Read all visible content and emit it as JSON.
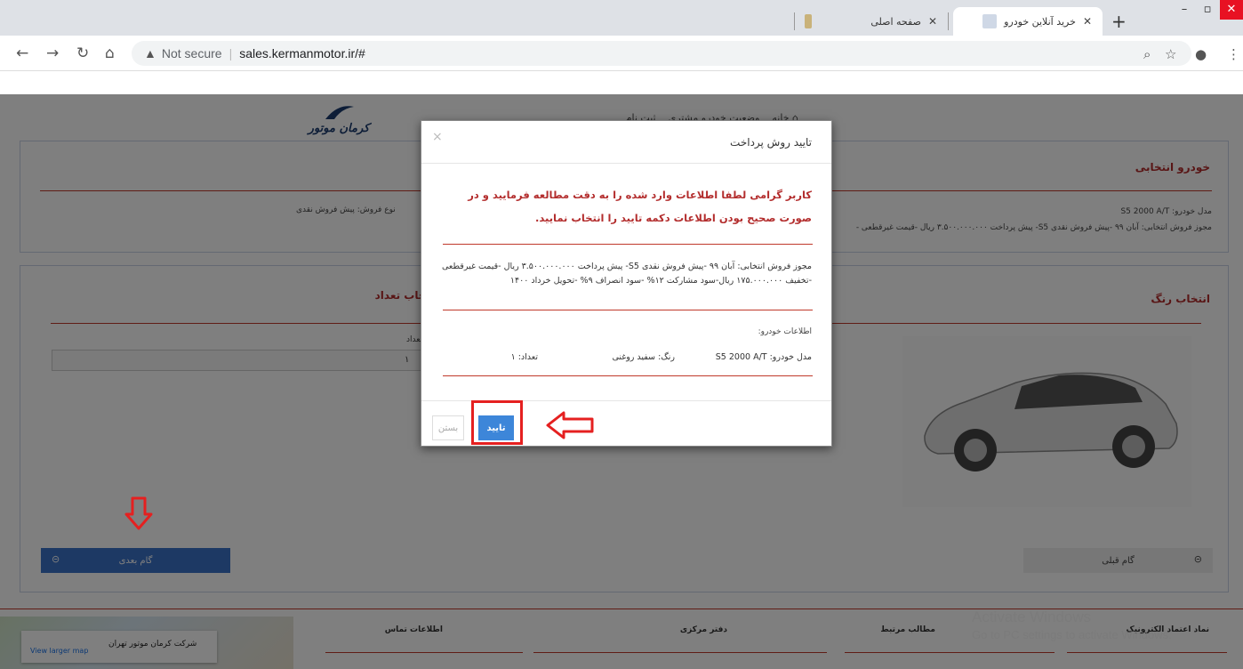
{
  "browser": {
    "tabs": [
      {
        "title": "خرید آنلاین خودرو",
        "active": true
      },
      {
        "title": "صفحه اصلی",
        "active": false
      },
      {
        "title": "",
        "active": false
      }
    ],
    "url_security": "Not secure",
    "url": "sales.kermanmotor.ir/#",
    "new_tab": "+"
  },
  "site": {
    "logo_text": "کرمان موتور",
    "nav": [
      "خانه",
      "وضعیت خودرو مشتری",
      "ثبت نام"
    ]
  },
  "car_section": {
    "title": "خودرو انتخابی",
    "model_label": "مدل خودرو:",
    "model_value": "S5 2000 A/T",
    "sale_type_label": "نوع فروش:",
    "sale_type_value": "پیش فروش نقدی",
    "license_label": "مجوز فروش انتخابی:",
    "license_value": "آبان ۹۹ -پیش فروش نقدی S5- پیش پرداخت ۳.۵۰۰.۰۰۰.۰۰۰ ریال -قیمت غیرقطعی -"
  },
  "color_section": {
    "title": "انتخاب رنگ",
    "qty_title": "انتخاب تعداد",
    "qty_label": "تعداد",
    "qty_value": "۱"
  },
  "buttons": {
    "next": "گام بعدی",
    "prev": "گام قبلی"
  },
  "footer": {
    "cols": [
      "نماد اعتماد الکترونیک",
      "مطالب مرتبط",
      "دفتر مرکزی",
      "اطلاعات تماس"
    ],
    "map_card_title": "شرکت کرمان موتور تهران",
    "map_link": "View larger map",
    "activate_line1": "Activate Windows",
    "activate_line2": "Go to PC settings to activate Windows."
  },
  "modal": {
    "title": "تایید روش پرداخت",
    "close_symbol": "×",
    "warning": "کاربر گرامی لطفا اطلاعات وارد شده را به دقت مطالعه فرمایید و در صورت صحیح بودن اطلاعات دکمه تایید را انتخاب نمایید.",
    "license_label": "مجوز فروش انتخابی:",
    "license_value": "آبان ۹۹ -پیش فروش نقدی S5- پیش پرداخت ۳.۵۰۰.۰۰۰.۰۰۰ ریال -قیمت غیرقطعی -تخفیف ۱۷۵.۰۰۰.۰۰۰ ریال-سود مشارکت ۱۲% -سود انصراف ۹% -تحویل خرداد ۱۴۰۰",
    "car_info_label": "اطلاعات خودرو:",
    "model_label": "مدل خودرو:",
    "model_value": "S5 2000 A/T",
    "color_label": "رنگ:",
    "color_value": "سفید روغنی",
    "count_label": "تعداد:",
    "count_value": "۱",
    "confirm": "تایید",
    "cancel": "بستن"
  },
  "colors": {
    "accent_red": "#b32d2d",
    "button_blue": "#3d86d9",
    "annotation_red": "#e52020"
  }
}
